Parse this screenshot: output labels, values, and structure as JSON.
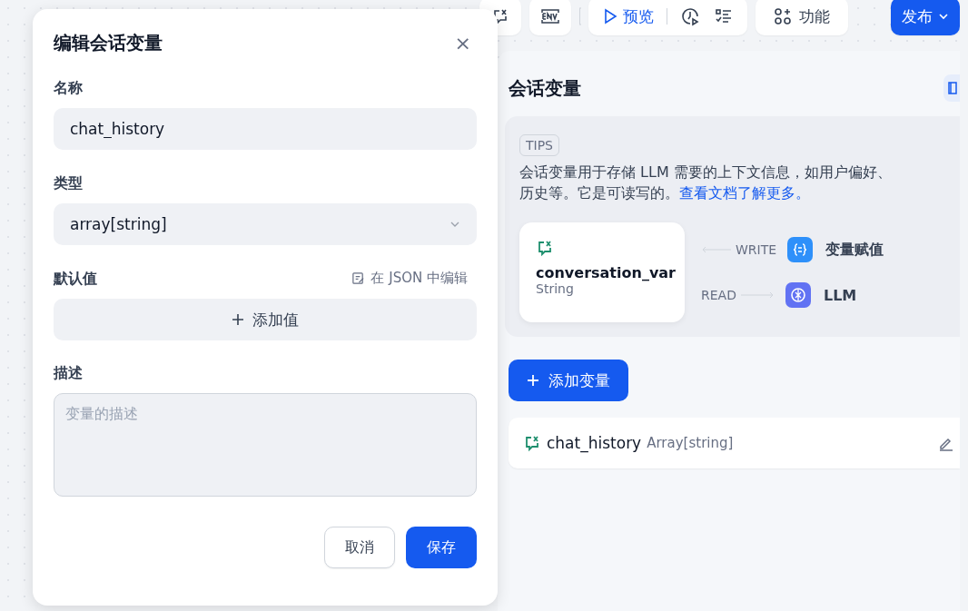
{
  "toolbar": {
    "preview": "预览",
    "features": "功能",
    "publish": "发布"
  },
  "dialog": {
    "title": "编辑会话变量",
    "close": "×",
    "name_label": "名称",
    "name_value": "chat_history",
    "type_label": "类型",
    "type_value": "array[string]",
    "default_label": "默认值",
    "json_edit": "在 JSON 中编辑",
    "add_value": "添加值",
    "desc_label": "描述",
    "desc_placeholder": "变量的描述",
    "buttons": [
      {
        "label": "取消",
        "kind": "secondary"
      },
      {
        "label": "保存",
        "kind": "primary"
      }
    ]
  },
  "panel": {
    "title": "会话变量",
    "tips_badge": "TIPS",
    "tips_line1": "会话变量用于存储 LLM 需要的上下文信息，如用户偏好、",
    "tips_line2": "历史等。它是可读写的。",
    "tips_link": "查看文档了解更多。",
    "example": {
      "name": "conversation_var",
      "type": "String",
      "write": "WRITE",
      "write_target": "变量赋值",
      "read": "READ",
      "read_target": "LLM"
    },
    "add_button": "添加变量",
    "variables": [
      {
        "name": "chat_history",
        "type": "Array[string]"
      }
    ]
  }
}
